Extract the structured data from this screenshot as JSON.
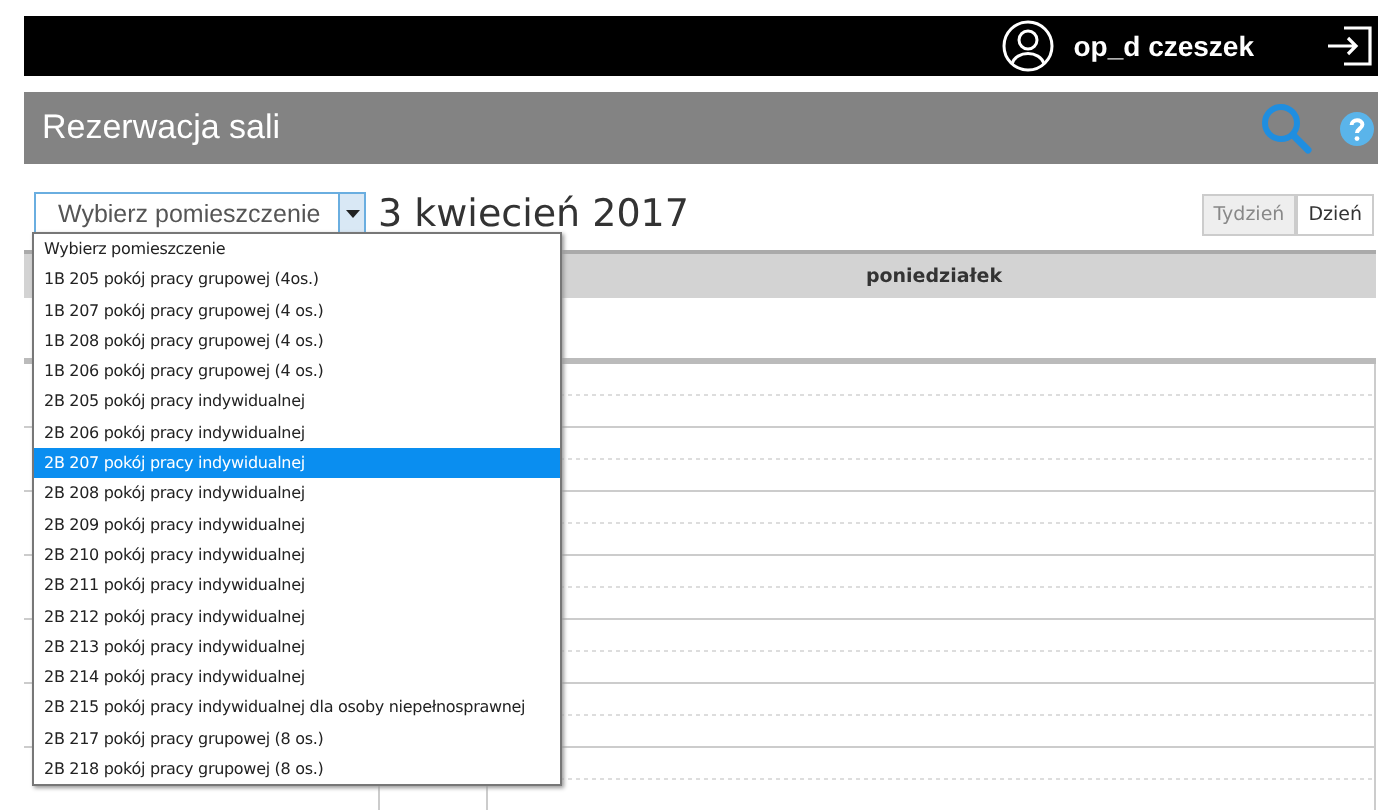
{
  "top_bar": {
    "user": "op_d czeszek"
  },
  "header": {
    "title": "Rezerwacja sali"
  },
  "toolbar": {
    "room_select": {
      "value": "Wybierz pomieszczenie",
      "expanded": true
    },
    "date": "3 kwiecień 2017",
    "view_buttons": [
      {
        "label": "Tydzień",
        "selected": false
      },
      {
        "label": "Dzień",
        "selected": true
      }
    ]
  },
  "dropdown": {
    "options": [
      {
        "label": "Wybierz pomieszczenie",
        "selected": false
      },
      {
        "label": "1B 205 pokój pracy grupowej (4os.)",
        "selected": false
      },
      {
        "label": "1B 207 pokój pracy grupowej (4 os.)",
        "selected": false
      },
      {
        "label": "1B 208 pokój pracy grupowej (4 os.)",
        "selected": false
      },
      {
        "label": "1B 206 pokój pracy grupowej (4 os.)",
        "selected": false
      },
      {
        "label": "2B 205 pokój pracy indywidualnej",
        "selected": false
      },
      {
        "label": "2B 206 pokój pracy indywidualnej",
        "selected": false
      },
      {
        "label": "2B 207 pokój pracy indywidualnej",
        "selected": true
      },
      {
        "label": "2B 208 pokój pracy indywidualnej",
        "selected": false
      },
      {
        "label": "2B 209 pokój pracy indywidualnej",
        "selected": false
      },
      {
        "label": "2B 210 pokój pracy indywidualnej",
        "selected": false
      },
      {
        "label": "2B 211 pokój pracy indywidualnej",
        "selected": false
      },
      {
        "label": "2B 212 pokój pracy indywidualnej",
        "selected": false
      },
      {
        "label": "2B 213 pokój pracy indywidualnej",
        "selected": false
      },
      {
        "label": "2B 214 pokój pracy indywidualnej",
        "selected": false
      },
      {
        "label": "2B 215 pokój pracy indywidualnej dla osoby niepełnosprawnej",
        "selected": false
      },
      {
        "label": "2B 217 pokój pracy grupowej (8 os.)",
        "selected": false
      },
      {
        "label": "2B 218 pokój pracy grupowej (8 os.)",
        "selected": false
      }
    ]
  },
  "calendar": {
    "day_header": "poniedziałek"
  }
}
